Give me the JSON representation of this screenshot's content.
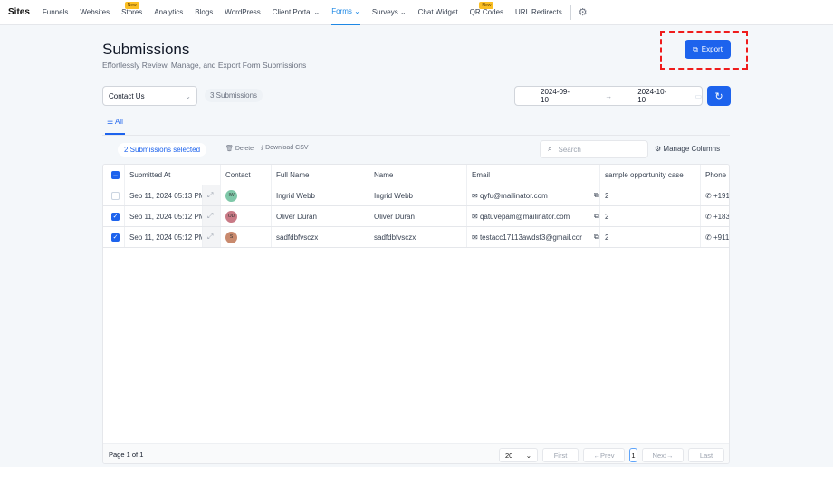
{
  "nav": {
    "brand": "Sites",
    "items": [
      {
        "label": "Funnels"
      },
      {
        "label": "Websites"
      },
      {
        "label": "Stores",
        "badge": "New"
      },
      {
        "label": "Analytics"
      },
      {
        "label": "Blogs"
      },
      {
        "label": "WordPress"
      },
      {
        "label": "Client Portal ⌄"
      },
      {
        "label": "Forms ⌄",
        "active": true
      },
      {
        "label": "Surveys ⌄"
      },
      {
        "label": "Chat Widget"
      },
      {
        "label": "QR Codes",
        "badge": "New"
      },
      {
        "label": "URL Redirects"
      }
    ]
  },
  "page": {
    "title": "Submissions",
    "subtitle": "Effortlessly Review, Manage, and Export Form Submissions",
    "export": "Export",
    "form_select": "Contact Us",
    "count": "3 Submissions",
    "date_from": "2024-09-10",
    "date_to": "2024-10-10",
    "tab": "All"
  },
  "toolbar": {
    "selected": "2 Submissions selected",
    "delete": "Delete",
    "download": "Download CSV",
    "search_placeholder": "Search",
    "manage": "Manage Columns"
  },
  "table": {
    "headers": [
      "Submitted At",
      "Contact",
      "Full Name",
      "Name",
      "Email",
      "sample opportunity case",
      "Phone"
    ],
    "rows": [
      {
        "checked": false,
        "submitted": "Sep 11, 2024 05:13 PM",
        "initials": "IW",
        "avatar": "#7fc8a9",
        "full": "Ingrid Webb",
        "name": "Ingrid Webb",
        "email": "qyfu@mailinator.com",
        "case": "2",
        "phone": "+191"
      },
      {
        "checked": true,
        "submitted": "Sep 11, 2024 05:12 PM",
        "initials": "OD",
        "avatar": "#c97a86",
        "full": "Oliver Duran",
        "name": "Oliver Duran",
        "email": "qatuvepam@mailinator.com",
        "case": "2",
        "phone": "+183"
      },
      {
        "checked": true,
        "submitted": "Sep 11, 2024 05:12 PM",
        "initials": "S",
        "avatar": "#c98a6e",
        "full": "sadfdbfvsczx",
        "name": "sadfdbfvsczx",
        "email": "testacc17113awdsf3@gmail.cor",
        "case": "2",
        "phone": "+911"
      }
    ]
  },
  "pager": {
    "info": "Page 1 of 1",
    "per_page": "20",
    "first": "First",
    "prev": "Prev",
    "page": "1",
    "next": "Next",
    "last": "Last"
  }
}
